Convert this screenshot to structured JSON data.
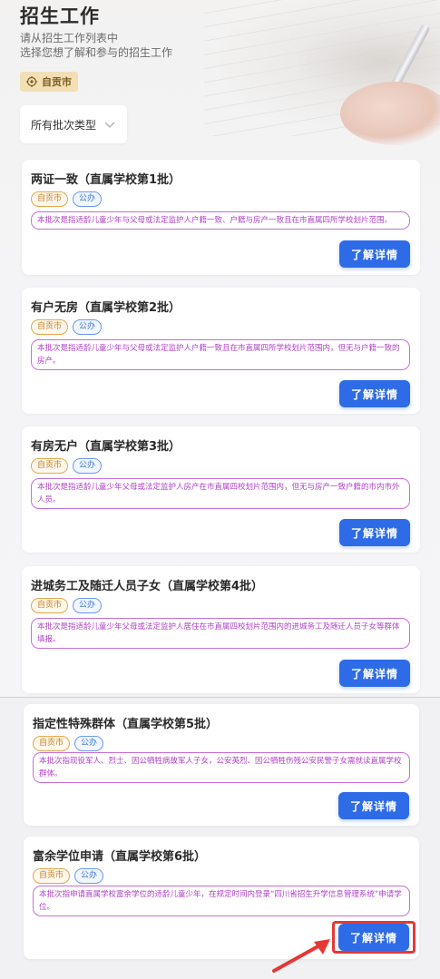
{
  "header": {
    "title": "招生工作",
    "subtitle_line1": "请从招生工作列表中",
    "subtitle_line2": "选择您想了解和参与的招生工作",
    "city": "自贡市"
  },
  "filter": {
    "label": "所有批次类型"
  },
  "cards": [
    {
      "title": "两证一致（直属学校第1批）",
      "tag_city": "自贡市",
      "tag_type": "公办",
      "description": "本批次是指适龄儿童少年与父母或法定监护人户籍一致、户籍与房产一致且在市直属四所学校划片范围。",
      "button": "了解详情"
    },
    {
      "title": "有户无房（直属学校第2批）",
      "tag_city": "自贡市",
      "tag_type": "公办",
      "description": "本批次是指适龄儿童少年与父母或法定监护人户籍一致且在市直属四所学校划片范围内，但无与户籍一致的房产。",
      "button": "了解详情"
    },
    {
      "title": "有房无户（直属学校第3批）",
      "tag_city": "自贡市",
      "tag_type": "公办",
      "description": "本批次是指适龄儿童少年父母或法定监护人房产在市直属四校划片范围内，但无与房产一致户籍的市内市外人员。",
      "button": "了解详情"
    },
    {
      "title": "进城务工及随迁人员子女（直属学校第4批）",
      "tag_city": "自贡市",
      "tag_type": "公办",
      "description": "本批次是指适龄儿童少年父母或法定监护人居住在市直属四校划片范围内的进城务工及随迁人员子女等群体填报。",
      "button": "了解详情"
    },
    {
      "title": "指定性特殊群体（直属学校第5批）",
      "tag_city": "自贡市",
      "tag_type": "公办",
      "description": "本批次指现役军人、烈士、因公牺牲病故军人子女，公安英烈、因公牺牲伤残公安民警子女需就读直属学校群体。",
      "button": "了解详情"
    },
    {
      "title": "富余学位申请（直属学校第6批）",
      "tag_city": "自贡市",
      "tag_type": "公办",
      "description": "本批次指申请直属学校富余学位的适龄儿童少年，在规定时间内登录“四川省招生升学信息管理系统”申请学位。",
      "button": "了解详情"
    }
  ],
  "colors": {
    "primary_button": "#2e6be6",
    "city_tag": "#e7a64c",
    "type_tag": "#6b9ae8",
    "description_border": "#c86fd9",
    "highlight": "#e53935"
  }
}
